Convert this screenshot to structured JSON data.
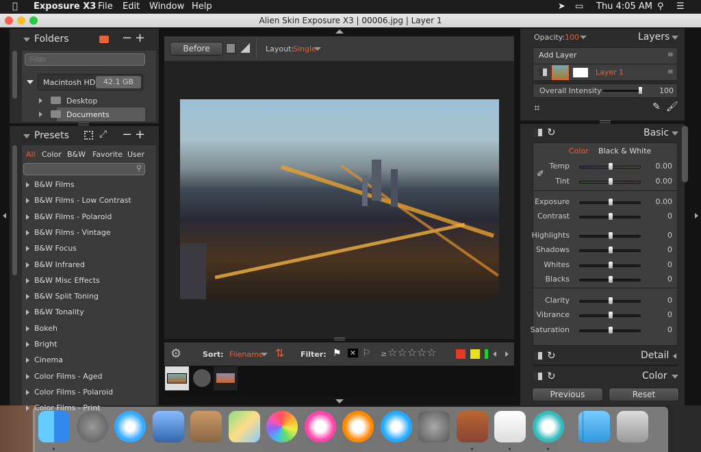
{
  "menubar": {
    "app": "Exposure X3",
    "items": [
      "File",
      "Edit",
      "Window",
      "Help"
    ],
    "clock": "Thu 4:05 AM"
  },
  "window": {
    "title": "Alien Skin Exposure X3 | 00006.jpg | Layer 1"
  },
  "folders": {
    "title": "Folders",
    "filter_placeholder": "Filter",
    "drive": "Macintosh HD",
    "drive_free": "42.1 GB",
    "items": [
      "Desktop",
      "Documents"
    ]
  },
  "presets": {
    "title": "Presets",
    "tabs": [
      "All",
      "Color",
      "B&W",
      "Favorite",
      "User"
    ],
    "active_tab": "All",
    "items": [
      "B&W Films",
      "B&W Films - Low Contrast",
      "B&W Films - Polaroid",
      "B&W Films - Vintage",
      "B&W Focus",
      "B&W Infrared",
      "B&W Misc Effects",
      "B&W Split Toning",
      "B&W Tonality",
      "Bokeh",
      "Bright",
      "Cinema",
      "Color Films - Aged",
      "Color Films - Polaroid",
      "Color Films - Print"
    ]
  },
  "toolbar": {
    "before_label": "Before",
    "layout_label": "Layout:",
    "layout_value": "Single"
  },
  "bottombar": {
    "sort_label": "Sort:",
    "sort_value": "Filename",
    "filter_label": "Filter:",
    "rating_prefix": "≥",
    "color_labels": [
      "#e53a2a",
      "#e8e020",
      "#22cc33"
    ]
  },
  "layers": {
    "opacity_label": "Opacity:",
    "opacity_value": "100",
    "title": "Layers",
    "add_layer": "Add Layer",
    "layer_name": "Layer 1",
    "intensity_label": "Overall Intensity",
    "intensity_value": "100",
    "intensity_level": 100
  },
  "basic": {
    "title": "Basic",
    "mode_color": "Color",
    "mode_bw": "Black & White",
    "sliders": [
      {
        "label": "Temp",
        "value": "0.00"
      },
      {
        "label": "Tint",
        "value": "0.00"
      },
      {
        "label": "Exposure",
        "value": "0.00"
      },
      {
        "label": "Contrast",
        "value": "0"
      },
      {
        "label": "Highlights",
        "value": "0"
      },
      {
        "label": "Shadows",
        "value": "0"
      },
      {
        "label": "Whites",
        "value": "0"
      },
      {
        "label": "Blacks",
        "value": "0"
      },
      {
        "label": "Clarity",
        "value": "0"
      },
      {
        "label": "Vibrance",
        "value": "0"
      },
      {
        "label": "Saturation",
        "value": "0"
      }
    ]
  },
  "sections": {
    "detail": "Detail",
    "color": "Color"
  },
  "buttons": {
    "previous": "Previous",
    "reset": "Reset"
  },
  "accent": "#e8623a",
  "dock": [
    "finder",
    "launchpad",
    "safari",
    "mail",
    "contacts",
    "maps",
    "photos",
    "itunes",
    "ibooks",
    "app-store",
    "system-preferences",
    "archive-utility",
    "textedit",
    "exposure",
    "downloads",
    "trash"
  ]
}
